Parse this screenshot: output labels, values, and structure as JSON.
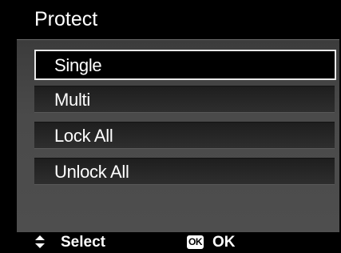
{
  "title": "Protect",
  "menu": {
    "items": [
      {
        "label": "Single",
        "selected": true
      },
      {
        "label": "Multi",
        "selected": false
      },
      {
        "label": "Lock All",
        "selected": false
      },
      {
        "label": "Unlock All",
        "selected": false
      }
    ]
  },
  "status_bar": {
    "nav_icon": "up-down-arrows-icon",
    "select_label": "Select",
    "ok_badge": "OK",
    "ok_label": "OK"
  },
  "colors": {
    "background": "#000000",
    "selection_border": "#e8e8e8",
    "text": "#ffffff"
  }
}
